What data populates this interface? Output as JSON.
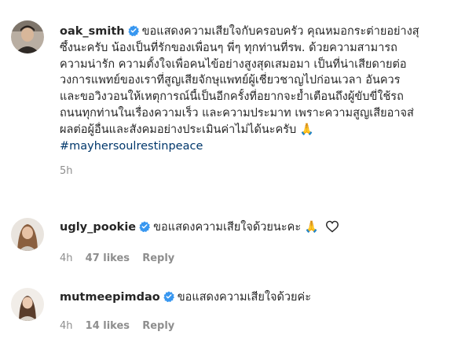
{
  "colors": {
    "verified": "#3897f0",
    "text": "#262626",
    "muted": "#8e8e8e",
    "hashtag": "#00376b"
  },
  "comments": [
    {
      "username": "oak_smith",
      "lines": [
        "ขอแสดงความเสียใจกับครอบครัว คุณหมอกระต่ายอย่างสุ",
        "ซึ้งนะครับ น้องเป็นที่รักของเพื่อนๆ พี่ๆ ทุกท่านที่รพ. ด้วยความสามารถ",
        "ความน่ารัก ความตั้งใจเพื่อคนไข้อย่างสูงสุดเสมอมา เป็นที่น่าเสียดายต่อ",
        "วงการแพทย์ของเราที่สูญเสียจักษุแพทย์ผู้เชี่ยวชาญไปก่อนเวลา อันควร",
        "และขอวิงวอนให้เหตุการณ์นี้เป็นอีกครั้งที่อยากจะย้ำเตือนถึงผู้ขับขี่ใช้รถ",
        "ถนนทุกท่านในเรื่องความเร็ว และความประมาท เพราะความสูญเสียอาจส่",
        "ผลต่อผู้อื่นและสังคมอย่างประเมินค่าไม่ได้นะครับ"
      ],
      "emoji": "🙏",
      "hashtag": "#mayhersoulrestinpeace",
      "time": "5h"
    },
    {
      "username": "ugly_pookie",
      "text": "ขอแสดงความเสียใจด้วยนะคะ",
      "emoji": "🙏",
      "time": "4h",
      "likes": "47 likes",
      "reply": "Reply"
    },
    {
      "username": "mutmeepimdao",
      "text": "ขอแสดงความเสียใจด้วยค่ะ",
      "time": "4h",
      "likes": "14 likes",
      "reply": "Reply"
    }
  ]
}
